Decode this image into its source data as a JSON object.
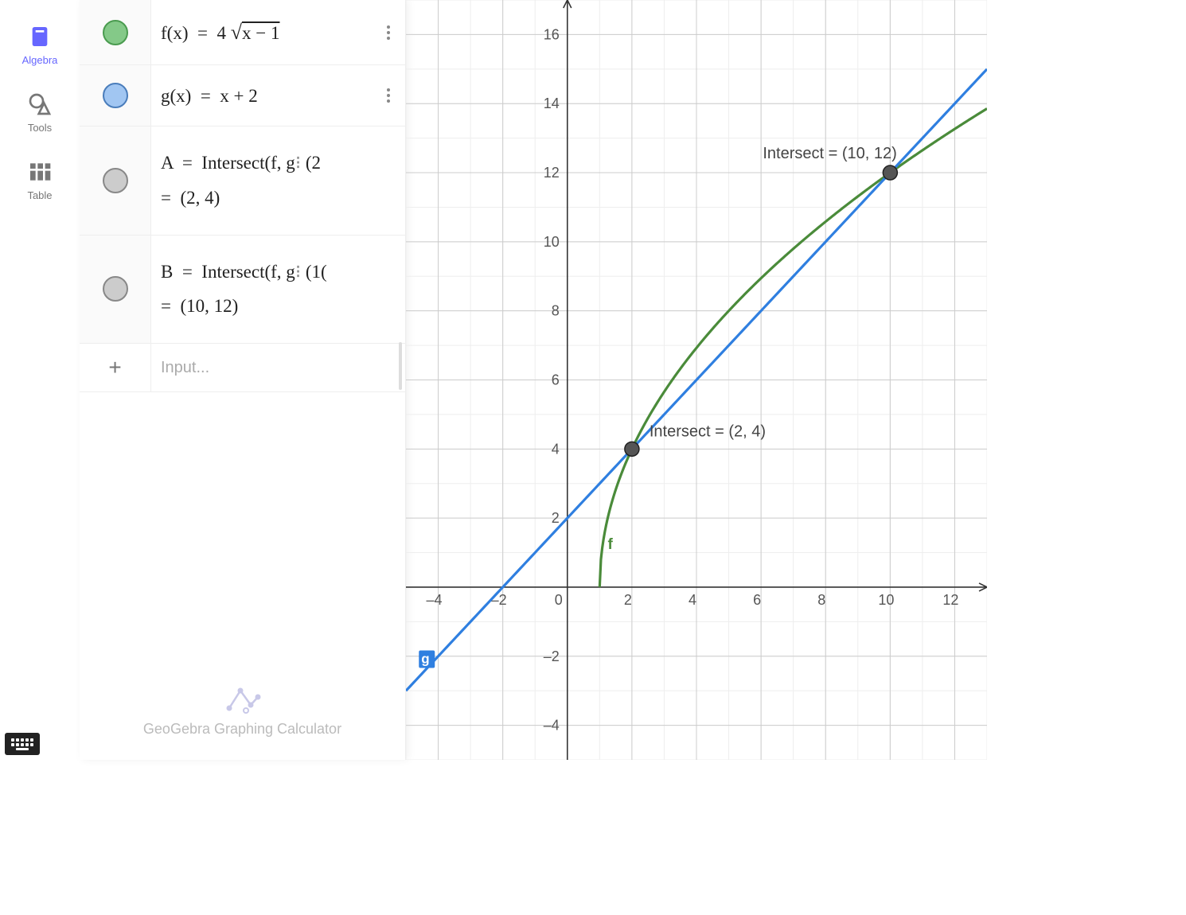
{
  "nav": {
    "algebra": "Algebra",
    "tools": "Tools",
    "table": "Table"
  },
  "rows": [
    {
      "color": "green",
      "formula_html": "f(x) &nbsp;=&nbsp; 4 <span style='font-size:26px'>&#8730;</span><span class='sqrt-line'>x &minus; 1</span>"
    },
    {
      "color": "blue",
      "formula_html": "g(x) &nbsp;=&nbsp; x + 2"
    },
    {
      "color": "gray",
      "formula_html": "A &nbsp;=&nbsp; Intersect(f, g<span style='color:#888'>&#8285;</span> (2<br>=&nbsp; (2, 4)"
    },
    {
      "color": "gray",
      "formula_html": "B &nbsp;=&nbsp; Intersect(f, g<span style='color:#888'>&#8285;</span> (1<span style='letter-spacing:-3px'>(</span><br>=&nbsp; (10, 12)"
    }
  ],
  "input_placeholder": "Input...",
  "footer_text": "GeoGebra Graphing Calculator",
  "graph_labels": {
    "A": "Intersect = (2, 4)",
    "B": "Intersect = (10, 12)",
    "f": "f",
    "g": "g"
  },
  "chart_data": {
    "type": "line",
    "title": "",
    "xlabel": "",
    "ylabel": "",
    "xlim": [
      -5,
      13
    ],
    "ylim": [
      -5,
      17
    ],
    "grid": true,
    "x_ticks": [
      -4,
      -2,
      0,
      2,
      4,
      6,
      8,
      10,
      12
    ],
    "y_ticks": [
      -4,
      -2,
      2,
      4,
      6,
      8,
      10,
      12,
      14,
      16
    ],
    "series": [
      {
        "name": "f",
        "color": "#4a8b3a",
        "definition": "f(x)=4*sqrt(x-1)",
        "domain": [
          1,
          13
        ]
      },
      {
        "name": "g",
        "color": "#2f7fe0",
        "definition": "g(x)=x+2",
        "domain": [
          -5,
          13
        ]
      }
    ],
    "points": [
      {
        "name": "A",
        "label": "Intersect = (2, 4)",
        "x": 2,
        "y": 4
      },
      {
        "name": "B",
        "label": "Intersect = (10, 12)",
        "x": 10,
        "y": 12
      }
    ]
  }
}
